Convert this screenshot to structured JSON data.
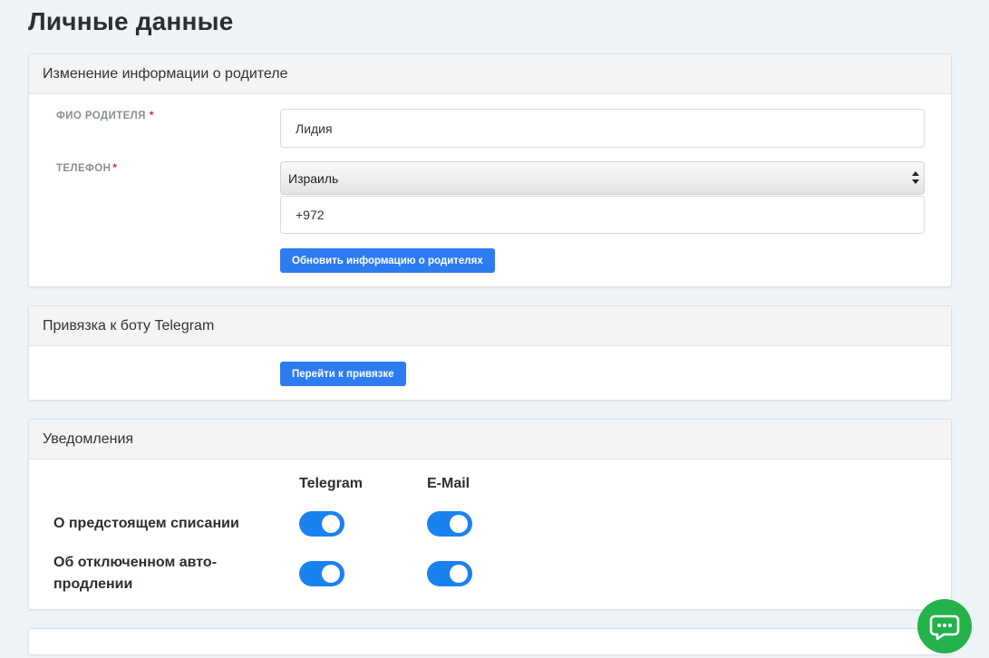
{
  "page": {
    "title": "Личные данные"
  },
  "parent_info": {
    "header": "Изменение информации о родителе",
    "name_label": "ФИО РОДИТЕЛЯ",
    "name_value": "Лидия",
    "phone_label": "ТЕЛЕФОН",
    "required_mark": "*",
    "country_selected": "Израиль",
    "phone_value": "+972",
    "update_button": "Обновить информацию о родителях"
  },
  "telegram": {
    "header": "Привязка к боту Telegram",
    "link_button": "Перейти к привязке"
  },
  "notifications": {
    "header": "Уведомления",
    "columns": [
      "Telegram",
      "E-Mail"
    ],
    "rows": [
      {
        "label": "О предстоящем списании",
        "telegram": true,
        "email": true
      },
      {
        "label": "Об отключенном авто-продлении",
        "telegram": true,
        "email": true
      }
    ]
  },
  "colors": {
    "accent": "#2d7bf0",
    "toggle_on": "#1a82f0",
    "chat_button": "#24b24b",
    "required": "#e0263f"
  },
  "icons": {
    "chat": "chat-bubble-icon"
  }
}
